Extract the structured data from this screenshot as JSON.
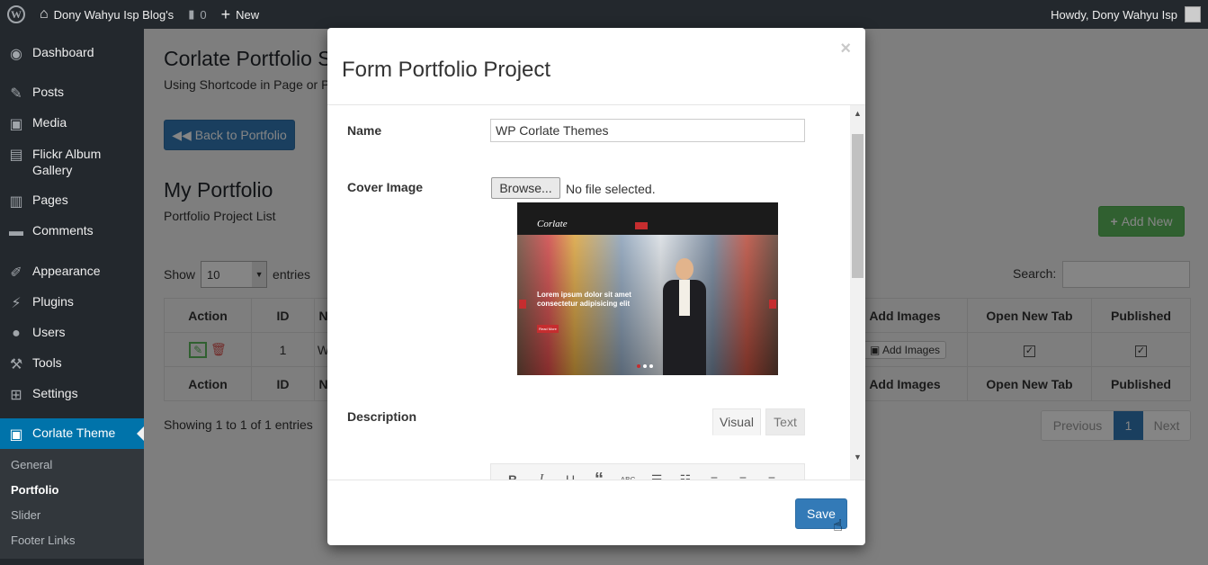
{
  "adminbar": {
    "site_name": "Dony Wahyu Isp Blog's",
    "comments_count": "0",
    "new_label": "New",
    "howdy": "Howdy, Dony Wahyu Isp"
  },
  "sidebar": {
    "items": [
      {
        "label": "Dashboard",
        "icon": "dashboard-icon"
      },
      {
        "label": "Posts",
        "icon": "pin-icon"
      },
      {
        "label": "Media",
        "icon": "media-icon"
      },
      {
        "label": "Flickr Album Gallery",
        "icon": "gallery-icon"
      },
      {
        "label": "Pages",
        "icon": "pages-icon"
      },
      {
        "label": "Comments",
        "icon": "comment-icon"
      },
      {
        "label": "Appearance",
        "icon": "brush-icon"
      },
      {
        "label": "Plugins",
        "icon": "plug-icon"
      },
      {
        "label": "Users",
        "icon": "user-icon"
      },
      {
        "label": "Tools",
        "icon": "wrench-icon"
      },
      {
        "label": "Settings",
        "icon": "settings-icon"
      },
      {
        "label": "Corlate Theme",
        "icon": "image-icon"
      }
    ],
    "submenu": [
      "General",
      "Portfolio",
      "Slider",
      "Footer Links"
    ]
  },
  "page": {
    "title": "Corlate Portfolio S",
    "subtitle": "Using Shortcode in Page or P",
    "back_button": "Back to Portfolio",
    "section_title": "My Portfolio",
    "section_subtitle": "Portfolio Project List",
    "add_new": "Add New",
    "show_label": "Show",
    "show_value": "10",
    "entries_label": "entries",
    "search_label": "Search:",
    "showing": "Showing 1 to 1 of 1 entries",
    "pagination": {
      "previous": "Previous",
      "current": "1",
      "next": "Next"
    },
    "table": {
      "headers_left": [
        "Action",
        "ID",
        "N"
      ],
      "headers_right": [
        "Add Images",
        "Open New Tab",
        "Published"
      ],
      "row_id": "1",
      "row_name": "W",
      "add_images_button": "Add Images"
    }
  },
  "modal": {
    "title": "Form Portfolio Project",
    "close": "×",
    "name_label": "Name",
    "name_value": "WP Corlate Themes",
    "cover_label": "Cover Image",
    "browse_button": "Browse...",
    "file_status": "No file selected.",
    "description_label": "Description",
    "tab_visual": "Visual",
    "tab_text": "Text",
    "preview": {
      "logo": "Corlate",
      "headline_1": "Lorem ipsum dolor sit amet",
      "headline_2": "consectetur adipisicing elit",
      "button": "Read More"
    },
    "save_button": "Save"
  },
  "colors": {
    "adminbar": "#23282d",
    "accent": "#0073aa",
    "primary": "#337ab7",
    "success": "#5cb85c"
  }
}
